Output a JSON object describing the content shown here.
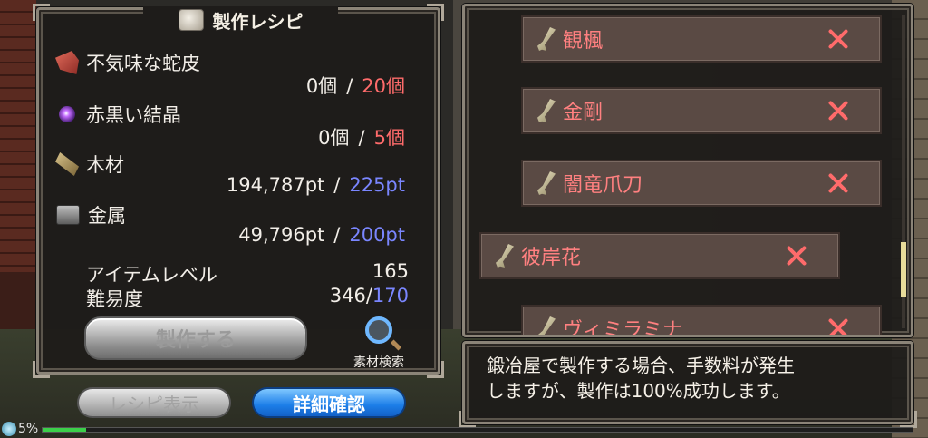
{
  "recipe_panel": {
    "title": "製作レシピ",
    "materials": [
      {
        "name": "不気味な蛇皮",
        "icon": "snake-skin-icon",
        "owned": "0個",
        "required": "20個",
        "required_color": "red"
      },
      {
        "name": "赤黒い結晶",
        "icon": "crystal-icon",
        "owned": "0個",
        "required": "5個",
        "required_color": "red"
      },
      {
        "name": "木材",
        "icon": "wood-icon",
        "owned": "194,787pt",
        "required": "225pt",
        "required_color": "blue"
      },
      {
        "name": "金属",
        "icon": "metal-icon",
        "owned": "49,796pt",
        "required": "200pt",
        "required_color": "blue"
      }
    ],
    "separator": "/",
    "item_level_label": "アイテムレベル",
    "item_level_value": "165",
    "difficulty_label": "難易度",
    "difficulty_current": "346/",
    "difficulty_max": "170",
    "craft_button": "製作する",
    "search_label": "素材検索"
  },
  "bottom_buttons": {
    "recipe_display": "レシピ表示",
    "detail_confirm": "詳細確認"
  },
  "recipe_list": [
    {
      "name": "観楓",
      "icon": "sword-icon"
    },
    {
      "name": "金剛",
      "icon": "sword-icon"
    },
    {
      "name": "闇竜爪刀",
      "icon": "sword-icon"
    },
    {
      "name": "彼岸花",
      "icon": "sword-icon",
      "selected": true
    },
    {
      "name": "ヴィミラミナ",
      "icon": "sword-icon"
    }
  ],
  "message": {
    "line1": "鍛冶屋で製作する場合、手数料が発生",
    "line2": "しますが、製作は100%成功します。"
  },
  "status": {
    "percent_text": "5%",
    "progress": 0.05
  },
  "colors": {
    "red": "#ff6b6b",
    "blue": "#7a86ff",
    "list_text": "#ff8080",
    "primary_button": "#1c7ee8"
  }
}
